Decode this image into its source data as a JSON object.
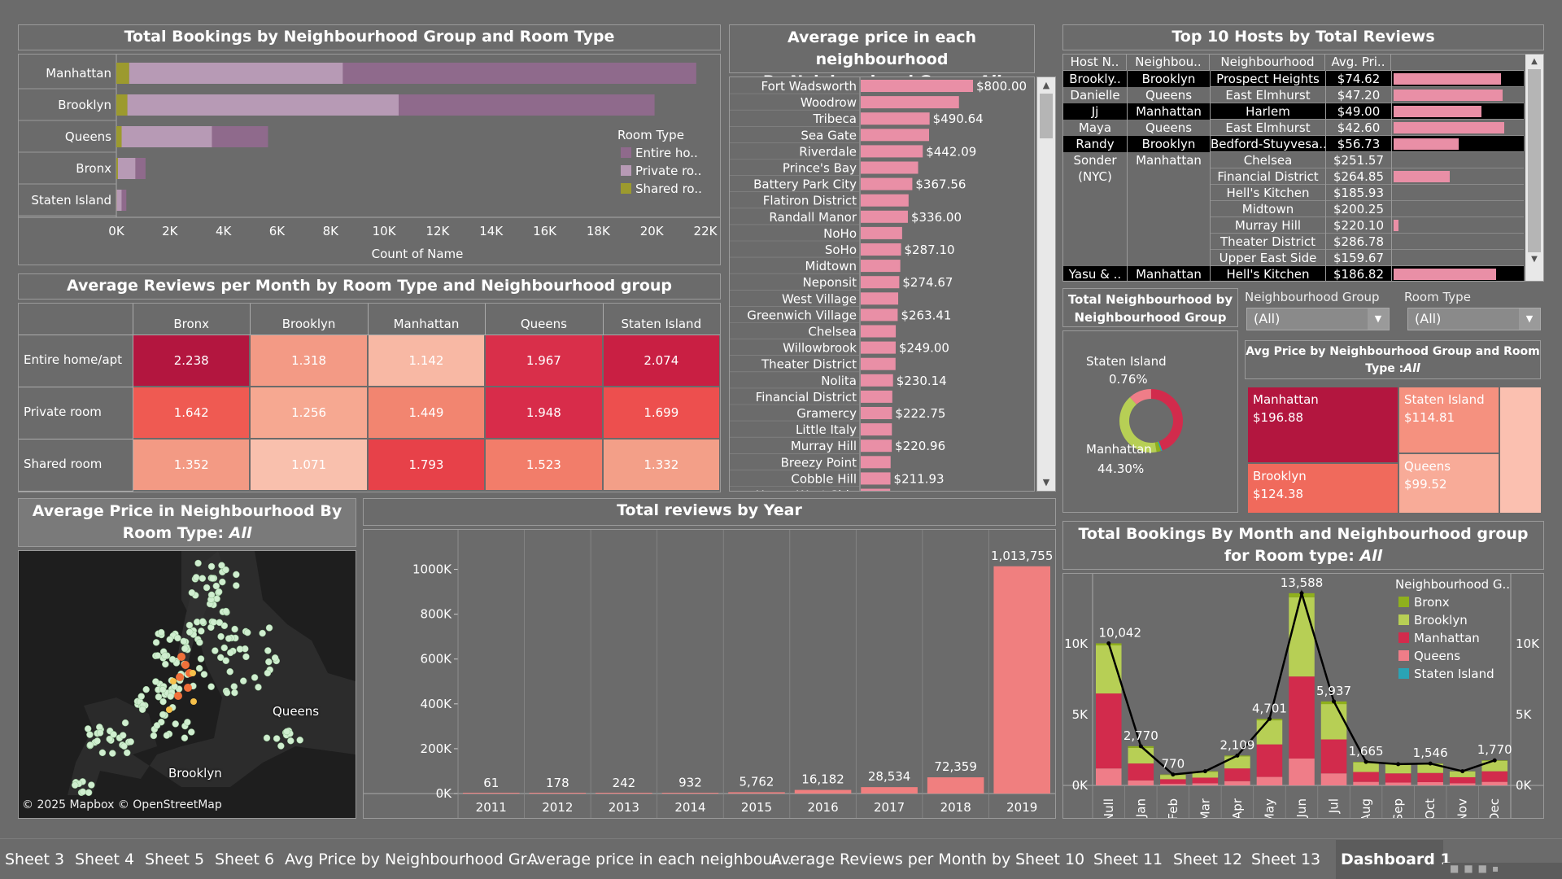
{
  "bookings": {
    "title": "Total Bookings by Neighbourhood Group and Room Type",
    "rows": [
      {
        "name": "Manhattan",
        "shared": 480,
        "private": 7980,
        "entire": 13200
      },
      {
        "name": "Brooklyn",
        "shared": 413,
        "private": 10132,
        "entire": 9559
      },
      {
        "name": "Queens",
        "shared": 198,
        "private": 3372,
        "entire": 2096
      },
      {
        "name": "Bronx",
        "shared": 60,
        "private": 652,
        "entire": 379
      },
      {
        "name": "Staten Island",
        "shared": 9,
        "private": 188,
        "entire": 176
      }
    ],
    "ticks": [
      "0K",
      "2K",
      "4K",
      "6K",
      "8K",
      "10K",
      "12K",
      "14K",
      "16K",
      "18K",
      "20K",
      "22K"
    ],
    "xlabel": "Count of Name",
    "legend_title": "Room Type",
    "legend": [
      {
        "label": "Entire ho..",
        "color": "#8f6a8c"
      },
      {
        "label": "Private ro..",
        "color": "#b79ab5"
      },
      {
        "label": "Shared ro..",
        "color": "#9c9a2e"
      }
    ]
  },
  "heatmap": {
    "title": "Average Reviews per Month by Room Type and Neighbourhood group",
    "cols": [
      "Bronx",
      "Brooklyn",
      "Manhattan",
      "Queens",
      "Staten Island"
    ],
    "rows": [
      {
        "name": "Entire home/apt",
        "vals": [
          "2.238",
          "1.318",
          "1.142",
          "1.967",
          "2.074"
        ],
        "colors": [
          "#b3163f",
          "#f39a85",
          "#f8b8a4",
          "#d92f4a",
          "#c91f43"
        ]
      },
      {
        "name": "Private room",
        "vals": [
          "1.642",
          "1.256",
          "1.449",
          "1.948",
          "1.699"
        ],
        "colors": [
          "#ef5a52",
          "#f6a891",
          "#f28570",
          "#d82c4a",
          "#ed4f4e"
        ]
      },
      {
        "name": "Shared room",
        "vals": [
          "1.352",
          "1.071",
          "1.793",
          "1.523",
          "1.332"
        ],
        "colors": [
          "#f39a84",
          "#f9c0ad",
          "#e74149",
          "#f27d6a",
          "#f39f88"
        ]
      }
    ]
  },
  "avg_price": {
    "title": "Average price in each neighbourhood",
    "subtitle_prefix": "By Neighourhood Group:",
    "subtitle_value": "All",
    "rows": [
      {
        "name": "Fort Wadsworth",
        "value": 800.0,
        "label": "$800.00"
      },
      {
        "name": "Woodrow",
        "value": 700,
        "label": ""
      },
      {
        "name": "Tribeca",
        "value": 490.64,
        "label": "$490.64"
      },
      {
        "name": "Sea Gate",
        "value": 487,
        "label": ""
      },
      {
        "name": "Riverdale",
        "value": 442.09,
        "label": "$442.09"
      },
      {
        "name": "Prince's Bay",
        "value": 409,
        "label": ""
      },
      {
        "name": "Battery Park City",
        "value": 367.56,
        "label": "$367.56"
      },
      {
        "name": "Flatiron District",
        "value": 341,
        "label": ""
      },
      {
        "name": "Randall Manor",
        "value": 336.0,
        "label": "$336.00"
      },
      {
        "name": "NoHo",
        "value": 295,
        "label": ""
      },
      {
        "name": "SoHo",
        "value": 287.1,
        "label": "$287.10"
      },
      {
        "name": "Midtown",
        "value": 282,
        "label": ""
      },
      {
        "name": "Neponsit",
        "value": 274.67,
        "label": "$274.67"
      },
      {
        "name": "West Village",
        "value": 267,
        "label": ""
      },
      {
        "name": "Greenwich Village",
        "value": 263.41,
        "label": "$263.41"
      },
      {
        "name": "Chelsea",
        "value": 249.7,
        "label": ""
      },
      {
        "name": "Willowbrook",
        "value": 249.0,
        "label": "$249.00"
      },
      {
        "name": "Theater District",
        "value": 248,
        "label": ""
      },
      {
        "name": "Nolita",
        "value": 230.14,
        "label": "$230.14"
      },
      {
        "name": "Financial District",
        "value": 225,
        "label": ""
      },
      {
        "name": "Gramercy",
        "value": 222.75,
        "label": "$222.75"
      },
      {
        "name": "Little Italy",
        "value": 222,
        "label": ""
      },
      {
        "name": "Murray Hill",
        "value": 220.96,
        "label": "$220.96"
      },
      {
        "name": "Breezy Point",
        "value": 213,
        "label": ""
      },
      {
        "name": "Cobble Hill",
        "value": 211.93,
        "label": "$211.93"
      },
      {
        "name": "Upper West Side",
        "value": 210,
        "label": ""
      }
    ]
  },
  "hosts": {
    "title": "Top 10 Hosts by Total Reviews",
    "headers": [
      "Host N..",
      "Neighbou..",
      "Neighbourhood",
      "Avg. Pri.."
    ],
    "rows": [
      {
        "host": "Brookly..",
        "group": "Brooklyn",
        "hood": "Prospect Heights",
        "price": "$74.62",
        "bar": 0.86,
        "dark": true
      },
      {
        "host": "Danielle",
        "group": "Queens",
        "hood": "East Elmhurst",
        "price": "$47.20",
        "bar": 0.87,
        "dark": false
      },
      {
        "host": "Jj",
        "group": "Manhattan",
        "hood": "Harlem",
        "price": "$49.00",
        "bar": 0.7,
        "dark": true
      },
      {
        "host": "Maya",
        "group": "Queens",
        "hood": "East Elmhurst",
        "price": "$42.60",
        "bar": 0.88,
        "dark": false
      },
      {
        "host": "Randy",
        "group": "Brooklyn",
        "hood": "Bedford-Stuyvesa..",
        "price": "$56.73",
        "bar": 0.52,
        "dark": true
      },
      {
        "host": "Sonder (NYC)",
        "group": "Manhattan",
        "hood": "Chelsea",
        "price": "$251.57",
        "bar": 0,
        "dark": false
      },
      {
        "host": "",
        "group": "",
        "hood": "Financial District",
        "price": "$264.85",
        "bar": 0.45,
        "dark": false
      },
      {
        "host": "",
        "group": "",
        "hood": "Hell's Kitchen",
        "price": "$185.93",
        "bar": 0,
        "dark": false
      },
      {
        "host": "",
        "group": "",
        "hood": "Midtown",
        "price": "$200.25",
        "bar": 0,
        "dark": false
      },
      {
        "host": "",
        "group": "",
        "hood": "Murray Hill",
        "price": "$220.10",
        "bar": 0.04,
        "dark": false
      },
      {
        "host": "",
        "group": "",
        "hood": "Theater District",
        "price": "$286.78",
        "bar": 0,
        "dark": false
      },
      {
        "host": "",
        "group": "",
        "hood": "Upper East Side",
        "price": "$159.67",
        "bar": 0,
        "dark": false
      },
      {
        "host": "Yasu & ..",
        "group": "Manhattan",
        "hood": "Hell's Kitchen",
        "price": "$186.82",
        "bar": 0.82,
        "dark": true
      }
    ]
  },
  "donut": {
    "title": "Total Neighbourhood by Neighbourhood Group",
    "label1": "Staten Island",
    "pct1": "0.76%",
    "label2": "Manhattan",
    "pct2": "44.30%",
    "segments": [
      {
        "name": "Manhattan",
        "share": 0.443,
        "color": "#d22b4c"
      },
      {
        "name": "Staten Island",
        "share": 0.0076,
        "color": "#2aa3b5"
      },
      {
        "name": "Bronx",
        "share": 0.022,
        "color": "#8fb01c"
      },
      {
        "name": "Brooklyn",
        "share": 0.411,
        "color": "#b7cf55"
      },
      {
        "name": "Queens",
        "share": 0.116,
        "color": "#ef7d88"
      }
    ]
  },
  "filters": {
    "group_label": "Neighbourhood Group",
    "group_value": "(All)",
    "room_label": "Room Type",
    "room_value": "(All)"
  },
  "treemap": {
    "title_prefix": "Avg Price by Neighbourhood Group and Room Type :",
    "title_value": "All",
    "cells": [
      {
        "name": "Manhattan",
        "value": "$196.88"
      },
      {
        "name": "Staten Island",
        "value": "$114.81"
      },
      {
        "name": "Brooklyn",
        "value": "$124.38"
      },
      {
        "name": "Queens",
        "value": "$99.52"
      }
    ]
  },
  "map": {
    "title_prefix": "Average Price in Neighbourhood By Room Type:",
    "title_value": "All",
    "label_queens": "Queens",
    "label_brooklyn": "Brooklyn",
    "attribution": "© 2025 Mapbox © OpenStreetMap"
  },
  "reviews_year": {
    "title": "Total reviews by Year",
    "chart_data": {
      "type": "bar",
      "categories": [
        "2011",
        "2012",
        "2013",
        "2014",
        "2015",
        "2016",
        "2017",
        "2018",
        "2019"
      ],
      "values": [
        61,
        178,
        242,
        932,
        5762,
        16182,
        28534,
        72359,
        1013755
      ],
      "labels": [
        "61",
        "178",
        "242",
        "932",
        "5,762",
        "16,182",
        "28,534",
        "72,359",
        "1,013,755"
      ],
      "ylim": [
        0,
        1140000
      ],
      "ticks": [
        {
          "v": 1000000,
          "t": "1000K"
        },
        {
          "v": 800000,
          "t": "800K"
        },
        {
          "v": 600000,
          "t": "600K"
        },
        {
          "v": 400000,
          "t": "400K"
        },
        {
          "v": 200000,
          "t": "200K"
        },
        {
          "v": 0,
          "t": "0K"
        }
      ]
    }
  },
  "monthly": {
    "title_prefix": "Total Bookings By Month and Neighbourhood group for Room type:",
    "title_value": "All",
    "months": [
      "Null",
      "Jan",
      "Feb",
      "Mar",
      "Apr",
      "May",
      "Jun",
      "Jul",
      "Aug",
      "Sep",
      "Oct",
      "Nov",
      "Dec"
    ],
    "totals": [
      10042,
      2770,
      770,
      1000,
      2109,
      4701,
      13588,
      5937,
      1665,
      1500,
      1546,
      1000,
      1770
    ],
    "labels": [
      "10,042",
      "2,770",
      "770",
      "",
      "2,109",
      "4,701",
      "13,588",
      "5,937",
      "1,665",
      "",
      "1,546",
      "",
      "1,770"
    ],
    "stack": [
      {
        "q": 1200,
        "m": 5300,
        "b": 3400,
        "bx": 142
      },
      {
        "q": 350,
        "m": 1200,
        "b": 1100,
        "bx": 120
      },
      {
        "q": 110,
        "m": 330,
        "b": 300,
        "bx": 30
      },
      {
        "q": 150,
        "m": 400,
        "b": 400,
        "bx": 50
      },
      {
        "q": 300,
        "m": 900,
        "b": 850,
        "bx": 59
      },
      {
        "q": 600,
        "m": 2300,
        "b": 1700,
        "bx": 101
      },
      {
        "q": 1900,
        "m": 5800,
        "b": 5600,
        "bx": 288
      },
      {
        "q": 850,
        "m": 2400,
        "b": 2500,
        "bx": 187
      },
      {
        "q": 250,
        "m": 700,
        "b": 680,
        "bx": 35
      },
      {
        "q": 200,
        "m": 650,
        "b": 620,
        "bx": 30
      },
      {
        "q": 230,
        "m": 650,
        "b": 630,
        "bx": 36
      },
      {
        "q": 150,
        "m": 430,
        "b": 400,
        "bx": 20
      },
      {
        "q": 250,
        "m": 750,
        "b": 730,
        "bx": 40
      }
    ],
    "ylim": [
      0,
      14500
    ],
    "ticks": [
      {
        "v": 10000,
        "t": "10K"
      },
      {
        "v": 5000,
        "t": "5K"
      },
      {
        "v": 0,
        "t": "0K"
      }
    ],
    "legend_title": "Neighbourhood G..",
    "legend": [
      {
        "label": "Bronx",
        "color": "#8fb01c"
      },
      {
        "label": "Brooklyn",
        "color": "#b7cf55"
      },
      {
        "label": "Manhattan",
        "color": "#d22b4c"
      },
      {
        "label": "Queens",
        "color": "#ef7d88"
      },
      {
        "label": "Staten Island",
        "color": "#2aa3b5"
      }
    ]
  },
  "tabs": [
    "Sheet 3",
    "Sheet 4",
    "Sheet 5",
    "Sheet 6",
    "Avg Price by Neighbourhood Gr...",
    "Average price in each neighbour...",
    "Average Reviews per Month by ...",
    "Sheet 10",
    "Sheet 11",
    "Sheet 12",
    "Sheet 13",
    "Dashboard 1"
  ],
  "colors": {
    "accent_pink": "#e98fa6",
    "accent_bar": "#f07f7f"
  }
}
